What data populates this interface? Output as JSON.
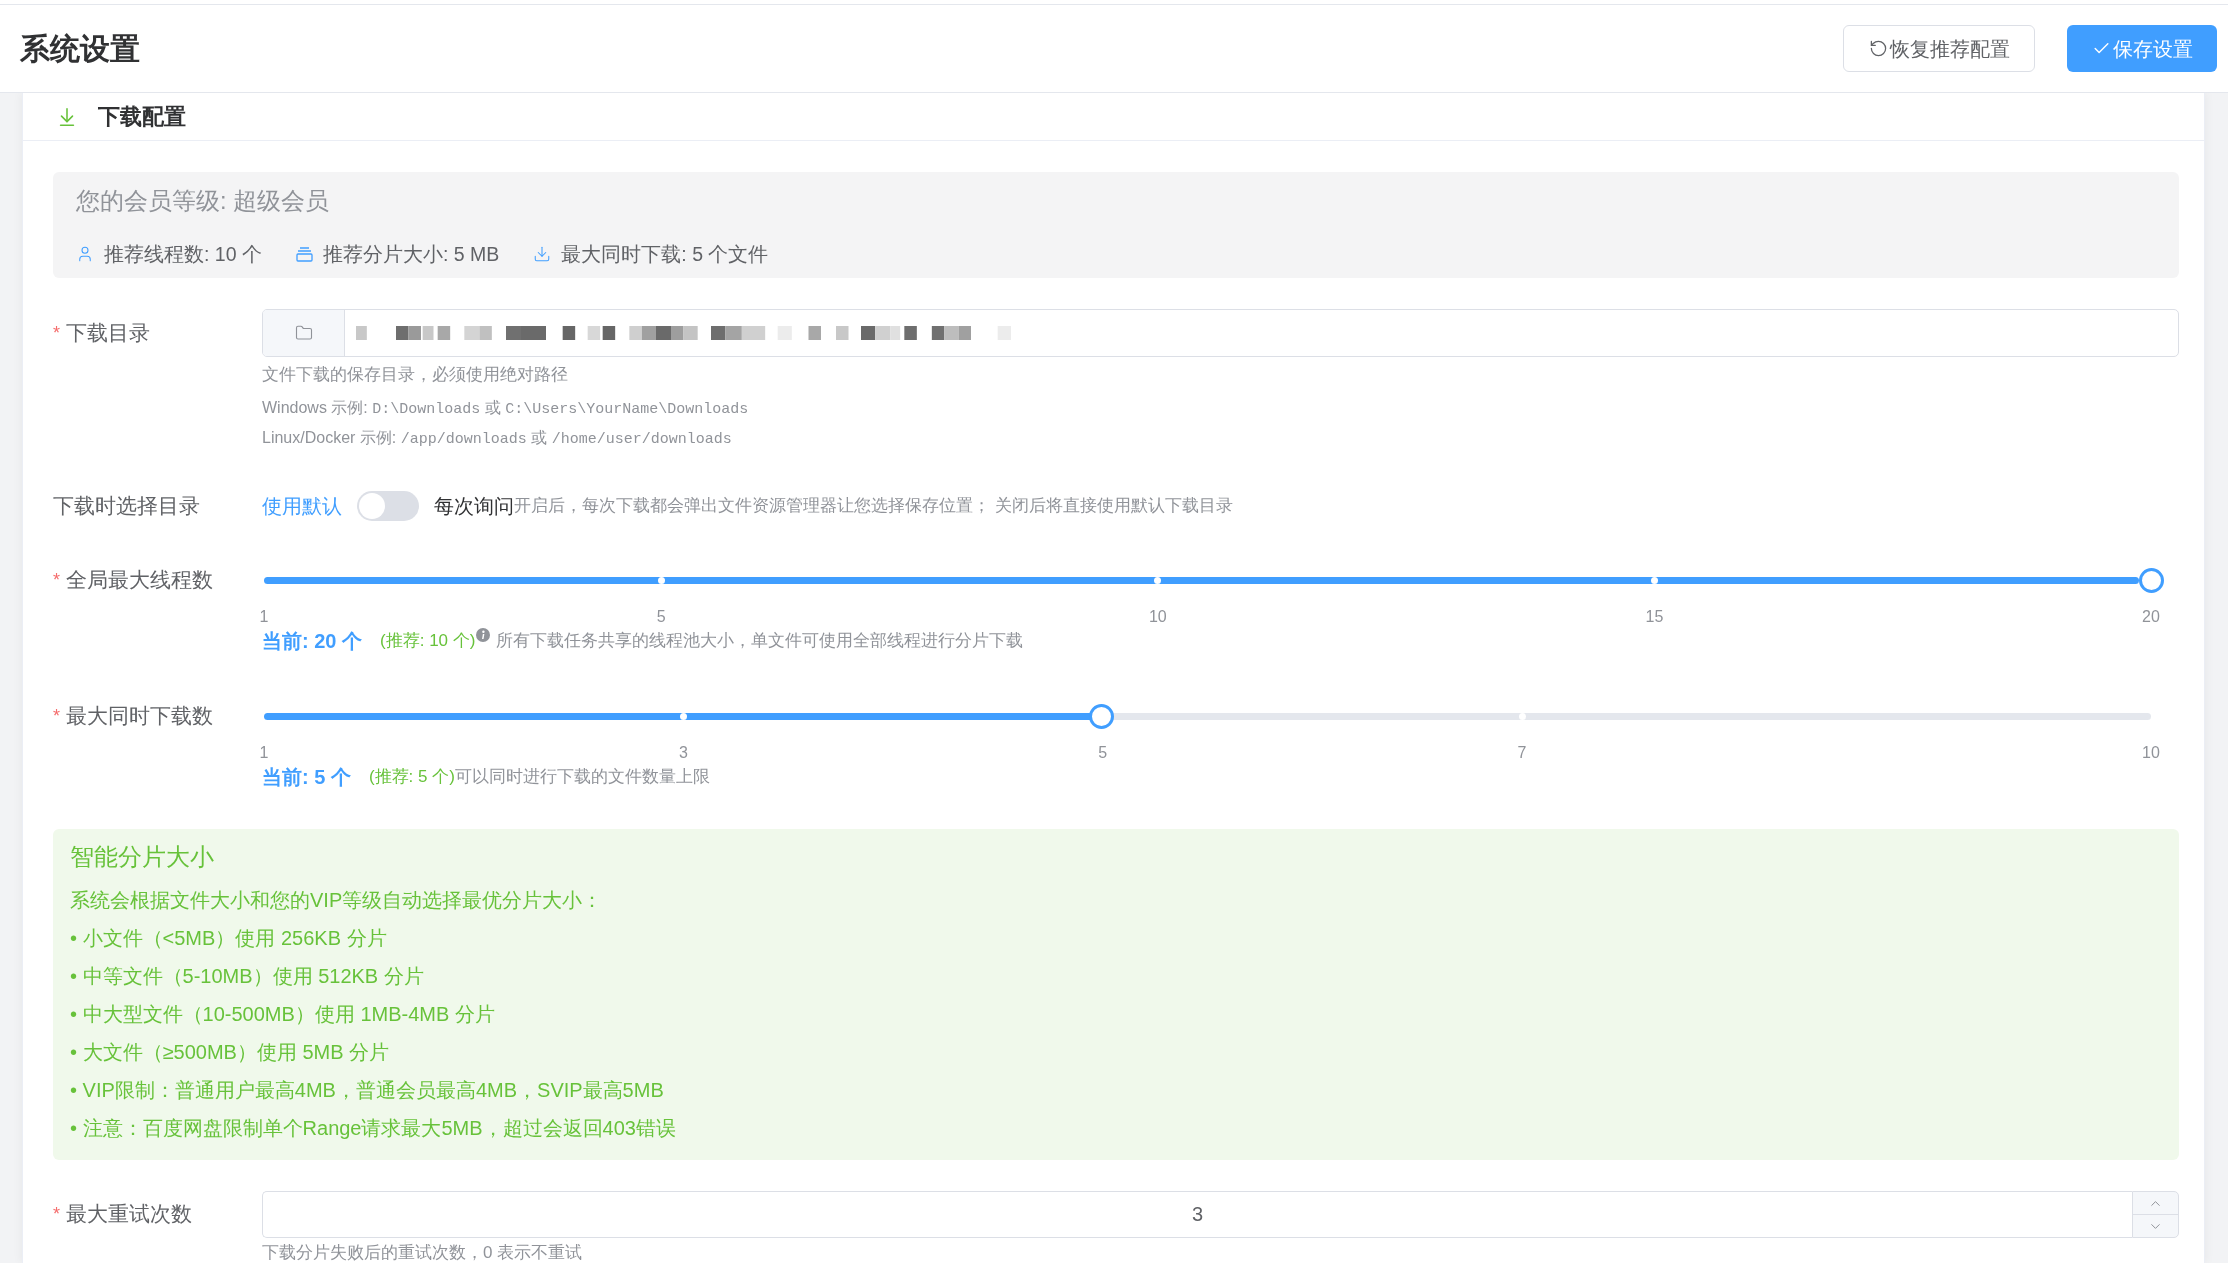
{
  "header": {
    "title": "系统设置",
    "buttons": [
      {
        "kind": "reset",
        "label": "恢复推荐配置"
      },
      {
        "kind": "save",
        "label": "保存设置"
      }
    ]
  },
  "section": {
    "title": "下载配置"
  },
  "membership": {
    "title": "您的会员等级: 超级会员",
    "stats": [
      {
        "kind": "user",
        "text": "推荐线程数: 10 个"
      },
      {
        "kind": "chunk",
        "text": "推荐分片大小: 5 MB"
      },
      {
        "kind": "download",
        "text": "最大同时下载: 5 个文件"
      }
    ]
  },
  "fields": [
    {
      "kind": "directory",
      "required_mark": "*",
      "label": "下载目录",
      "hint": "文件下载的保存目录，必须使用绝对路径",
      "examples": [
        {
          "segments": [
            {
              "kind": "plain",
              "text": "Windows 示例:"
            },
            {
              "kind": "code",
              "text": "D:\\Downloads"
            },
            {
              "kind": "plain",
              "text": "或"
            },
            {
              "kind": "code",
              "text": "C:\\Users\\YourName\\Downloads"
            }
          ]
        },
        {
          "segments": [
            {
              "kind": "plain",
              "text": "Linux/Docker 示例:"
            },
            {
              "kind": "code",
              "text": "/app/downloads"
            },
            {
              "kind": "plain",
              "text": "或"
            },
            {
              "kind": "code",
              "text": "/home/user/downloads"
            }
          ]
        }
      ]
    },
    {
      "kind": "switch",
      "label": "下载时选择目录",
      "off_label": "使用默认",
      "on_label": "每次询问",
      "on": false,
      "description": "开启后，每次下载都会弹出文件资源管理器让您选择保存位置； 关闭后将直接使用默认下载目录"
    },
    {
      "kind": "slider",
      "required_mark": "*",
      "label": "全局最大线程数",
      "level": 1,
      "marks": [
        "1",
        "5",
        "10",
        "15",
        "20"
      ],
      "current": "当前: 20 个",
      "recommended": "(推荐: 10 个)",
      "info_icon": true,
      "description": "所有下载任务共享的线程池大小，单文件可使用全部线程进行分片下载"
    },
    {
      "kind": "slider",
      "required_mark": "*",
      "label": "最大同时下载数",
      "level": 0.444,
      "marks": [
        "1",
        "3",
        "5",
        "7",
        "10"
      ],
      "current": "当前: 5 个",
      "recommended": "(推荐: 5 个)",
      "description": "可以同时进行下载的文件数量上限"
    },
    {
      "kind": "notice",
      "title": "智能分片大小",
      "intro": "系统会根据文件大小和您的VIP等级自动选择最优分片大小：",
      "bullets": [
        "• 小文件（<5MB）使用 256KB 分片",
        "• 中等文件（5-10MB）使用 512KB 分片",
        "• 中大型文件（10-500MB）使用 1MB-4MB 分片",
        "• 大文件（≥500MB）使用 5MB 分片",
        "• VIP限制：普通用户最高4MB，普通会员最高4MB，SVIP最高5MB",
        "• 注意：百度网盘限制单个Range请求最大5MB，超过会返回403错误"
      ]
    },
    {
      "kind": "number",
      "required_mark": "*",
      "label": "最大重试次数",
      "value": "3",
      "hint": "下载分片失败后的重试次数，0 表示不重试"
    }
  ]
}
